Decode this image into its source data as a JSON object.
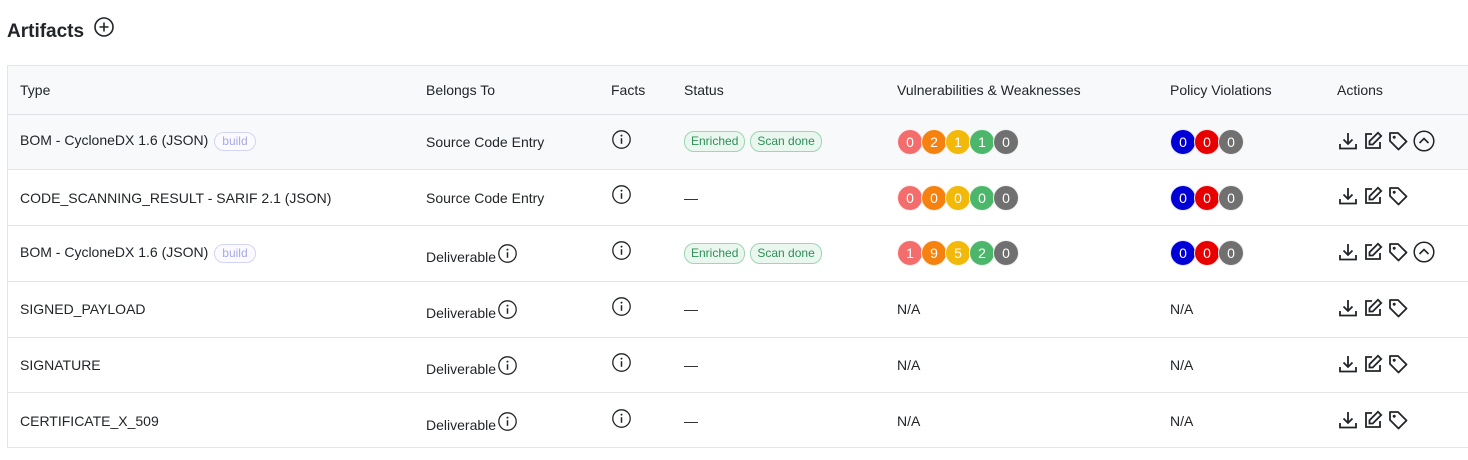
{
  "title": "Artifacts",
  "colors": {
    "critical": "#f46d6d",
    "high": "#f5820e",
    "medium": "#f2b80a",
    "low": "#4cb76b",
    "unassigned": "#707070",
    "fail": "#0000d6",
    "warn": "#e80000",
    "info": "#707070"
  },
  "columns": [
    "Type",
    "Belongs To",
    "Facts",
    "Status",
    "Vulnerabilities & Weaknesses",
    "Policy Violations",
    "Actions"
  ],
  "rows": [
    {
      "type": "BOM - CycloneDX 1.6 (JSON)",
      "tag": "build",
      "belongs_to": "Source Code Entry",
      "status": [
        "Enriched",
        "Scan done"
      ],
      "vulns": [
        "0",
        "2",
        "1",
        "1",
        "0"
      ],
      "policy": [
        "0",
        "0",
        "0"
      ],
      "actions": [
        "download-icon",
        "edit-icon",
        "tag-icon",
        "chevron-up-circle-icon"
      ]
    },
    {
      "type": "CODE_SCANNING_RESULT - SARIF 2.1 (JSON)",
      "belongs_to": "Source Code Entry",
      "status_text": "—",
      "vulns": [
        "0",
        "0",
        "0",
        "0",
        "0"
      ],
      "policy": [
        "0",
        "0",
        "0"
      ],
      "actions": [
        "download-icon",
        "edit-icon",
        "tag-icon"
      ]
    },
    {
      "type": "BOM - CycloneDX 1.6 (JSON)",
      "tag": "build",
      "belongs_to": "Deliverable",
      "status": [
        "Enriched",
        "Scan done"
      ],
      "vulns": [
        "1",
        "9",
        "5",
        "2",
        "0"
      ],
      "policy": [
        "0",
        "0",
        "0"
      ],
      "actions": [
        "download-icon",
        "edit-icon",
        "tag-icon",
        "chevron-up-circle-icon"
      ]
    },
    {
      "type": "SIGNED_PAYLOAD",
      "belongs_to": "Deliverable",
      "status_text": "—",
      "vulns_text": "N/A",
      "policy_text": "N/A",
      "actions": [
        "download-icon",
        "edit-icon",
        "tag-icon"
      ]
    },
    {
      "type": "SIGNATURE",
      "belongs_to": "Deliverable",
      "status_text": "—",
      "vulns_text": "N/A",
      "policy_text": "N/A",
      "actions": [
        "download-icon",
        "edit-icon",
        "tag-icon"
      ]
    },
    {
      "type": "CERTIFICATE_X_509",
      "belongs_to": "Deliverable",
      "status_text": "—",
      "vulns_text": "N/A",
      "policy_text": "N/A",
      "actions": [
        "download-icon",
        "edit-icon",
        "tag-icon"
      ]
    }
  ]
}
